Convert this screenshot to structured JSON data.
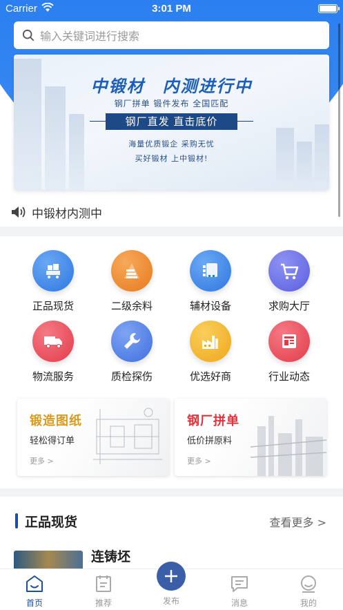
{
  "status_bar": {
    "carrier": "Carrier",
    "time": "3:01 PM"
  },
  "search": {
    "placeholder": "输入关键词进行搜索"
  },
  "banner": {
    "title": "中锻材　内测进行中",
    "subtitle": "钢厂拼单  锻件发布  全国匹配",
    "slogan": "钢厂直发  直击底价",
    "line1": "海量优质锻企   采购无忧",
    "line2": "买好锻材    上中锻材!"
  },
  "notice": {
    "text": "中锻材内测中"
  },
  "categories": [
    {
      "label": "正品现货",
      "icon": "cart-boxes-icon",
      "color": "#3f88e8"
    },
    {
      "label": "二级余料",
      "icon": "stack-triangle-icon",
      "color": "#ef8b2c"
    },
    {
      "label": "辅材设备",
      "icon": "device-icon",
      "color": "#3f88e8"
    },
    {
      "label": "求购大厅",
      "icon": "shopping-cart-icon",
      "color": "#6a6fe8"
    },
    {
      "label": "物流服务",
      "icon": "truck-icon",
      "color": "#ec4c5a"
    },
    {
      "label": "质检探伤",
      "icon": "wrench-icon",
      "color": "#4e7fe6"
    },
    {
      "label": "优选好商",
      "icon": "factory-icon",
      "color": "#f2b327"
    },
    {
      "label": "行业动态",
      "icon": "news-icon",
      "color": "#ec4c5a"
    }
  ],
  "promo_cards": [
    {
      "title": "锻造图纸",
      "subtitle": "轻松得订单",
      "more": "更多 >",
      "title_color": "#d99a1c"
    },
    {
      "title": "钢厂拼单",
      "subtitle": "低价拼原料",
      "more": "更多 >",
      "title_color": "#e0323c"
    }
  ],
  "products": {
    "section_title": "正品现货",
    "more": "查看更多 >",
    "first_item": "连铸坯"
  },
  "tabbar": [
    {
      "label": "首页",
      "icon": "home-icon",
      "active": true
    },
    {
      "label": "推荐",
      "icon": "recommend-icon",
      "active": false
    },
    {
      "label": "发布",
      "icon": "plus-icon",
      "active": false
    },
    {
      "label": "消息",
      "icon": "message-icon",
      "active": false
    },
    {
      "label": "我的",
      "icon": "profile-icon",
      "active": false
    }
  ]
}
